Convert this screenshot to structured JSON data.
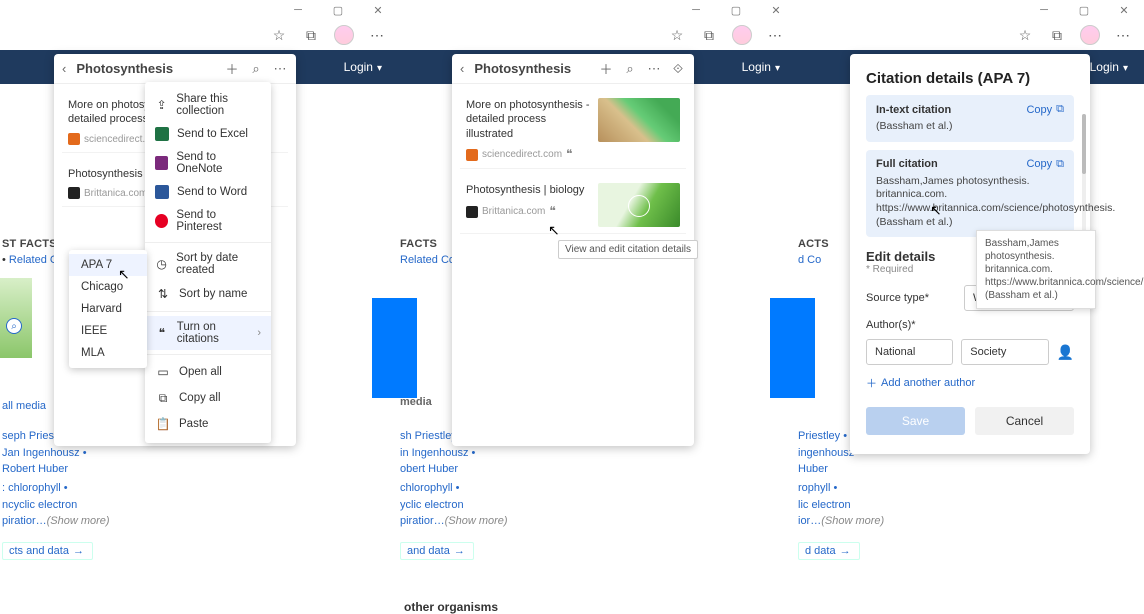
{
  "titlebar": {
    "min": "─",
    "max": "▢",
    "close": "✕"
  },
  "toolbar": {
    "dots": "⋯"
  },
  "bluebar": {
    "login": "Login"
  },
  "flyout1": {
    "title": "Photosynthesis",
    "card1_title": "More on photosynthesis -\ndetailed process illus",
    "card1_src": "sciencedirect.com",
    "card2_title": "Photosynthesis | biol",
    "card2_src": "Brittanica.com"
  },
  "flyout2": {
    "title": "Photosynthesis",
    "card1_title": "More on photosynthesis -\ndetailed process illustrated",
    "card1_src": "sciencedirect.com",
    "card2_title": "Photosynthesis | biology",
    "card2_src": "Brittanica.com",
    "tooltip": "View and edit citation details"
  },
  "ctx": {
    "share": "Share this collection",
    "excel": "Send to Excel",
    "onenote": "Send to OneNote",
    "word": "Send to Word",
    "pinterest": "Send to Pinterest",
    "sort_date": "Sort by date created",
    "sort_name": "Sort by name",
    "citations": "Turn on citations",
    "open_all": "Open all",
    "copy_all": "Copy all",
    "paste": "Paste"
  },
  "sub": {
    "apa7": "APA 7",
    "chicago": "Chicago",
    "harvard": "Harvard",
    "ieee": "IEEE",
    "mla": "MLA"
  },
  "cite": {
    "title": "Citation details (APA 7)",
    "intext_lbl": "In-text citation",
    "copy": "Copy",
    "intext_body": "(Bassham et al.)",
    "full_lbl": "Full citation",
    "full_body": "Bassham,James photosynthesis. britannica.com. https://www.britannica.com/science/photosynthesis. (Bassham et al.)",
    "tooltip": "Bassham,James photosynthesis. britannica.com. https://www.britannica.com/science/photosynthesis. (Bassham et al.)",
    "edit_head": "Edit details",
    "required": "* Required",
    "source_lbl": "Source type*",
    "source_val": "Website",
    "authors_lbl": "Author(s)*",
    "auth_first": "National",
    "auth_last": "Society",
    "add_author": "Add another author",
    "save": "Save",
    "cancel": "Cancel",
    "orange": "ource"
  },
  "bg": {
    "facts_title": "ST FACTS",
    "facts_title2": "FACTS",
    "facts_title3": "ACTS",
    "related": "Related Co",
    "all_media": "all media",
    "people": {
      "p1": "seph Priestley",
      "p1b": "sh Priestley",
      "p1c": "Priestley",
      "p2": "Jan Ingenhousz",
      "p2b": "in Ingenhousz",
      "p2c": "ingenhousz",
      "p3": "Robert Huber",
      "p3b": "obert Huber"
    },
    "topics": {
      "t1": "chlorophyll",
      "t2": "ncyclic electron",
      "t2b": "yclic electron",
      "t2c": "lic electron",
      "t3": "piratior",
      "t3b": "ior",
      "show": "(Show more)"
    },
    "facts_btn": "cts and data",
    "facts_btn2": "and data",
    "facts_btn3": "d data",
    "other_org": "other organisms"
  }
}
